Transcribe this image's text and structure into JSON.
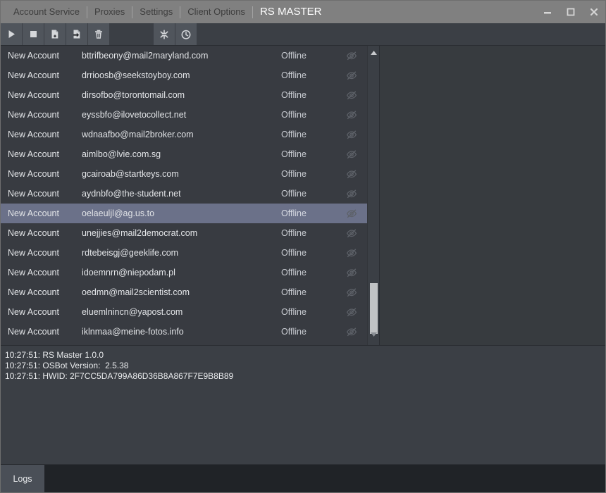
{
  "window": {
    "title": "RS MASTER",
    "menu": [
      "Account Service",
      "Proxies",
      "Settings",
      "Client Options"
    ],
    "controls": {
      "minimize": "minimize-icon",
      "maximize": "maximize-icon",
      "close": "close-icon"
    }
  },
  "toolbar": {
    "buttons": [
      {
        "icon": "play-icon",
        "name": "start-button"
      },
      {
        "icon": "stop-icon",
        "name": "stop-button"
      },
      {
        "icon": "add-file-icon",
        "name": "add-account-button"
      },
      {
        "icon": "import-file-icon",
        "name": "import-accounts-button"
      },
      {
        "icon": "trash-icon",
        "name": "delete-account-button"
      }
    ],
    "buttons_right": [
      {
        "icon": "tools-icon",
        "name": "tools-button"
      },
      {
        "icon": "clock-icon",
        "name": "scheduler-button"
      }
    ]
  },
  "accounts": {
    "status_icon": "eye-hidden-icon",
    "selected_index": 8,
    "rows": [
      {
        "name": "New Account",
        "email": "bttrifbeony@mail2maryland.com",
        "status": "Offline"
      },
      {
        "name": "New Account",
        "email": "drrioosb@seekstoyboy.com",
        "status": "Offline"
      },
      {
        "name": "New Account",
        "email": "dirsofbo@torontomail.com",
        "status": "Offline"
      },
      {
        "name": "New Account",
        "email": "eyssbfo@ilovetocollect.net",
        "status": "Offline"
      },
      {
        "name": "New Account",
        "email": "wdnaafbo@mail2broker.com",
        "status": "Offline"
      },
      {
        "name": "New Account",
        "email": "aimlbo@lvie.com.sg",
        "status": "Offline"
      },
      {
        "name": "New Account",
        "email": "gcairoab@startkeys.com",
        "status": "Offline"
      },
      {
        "name": "New Account",
        "email": "aydnbfo@the-student.net",
        "status": "Offline"
      },
      {
        "name": "New Account",
        "email": "oelaeuljl@ag.us.to",
        "status": "Offline"
      },
      {
        "name": "New Account",
        "email": "unejjies@mail2democrat.com",
        "status": "Offline"
      },
      {
        "name": "New Account",
        "email": "rdtebeisgj@geeklife.com",
        "status": "Offline"
      },
      {
        "name": "New Account",
        "email": "idoemnrn@niepodam.pl",
        "status": "Offline"
      },
      {
        "name": "New Account",
        "email": "oedmn@mail2scientist.com",
        "status": "Offline"
      },
      {
        "name": "New Account",
        "email": "eluemlnincn@yapost.com",
        "status": "Offline"
      },
      {
        "name": "New Account",
        "email": "iklnmaa@meine-fotos.info",
        "status": "Offline"
      }
    ]
  },
  "log": {
    "lines": [
      "10:27:51: RS Master 1.0.0",
      "10:27:51: OSBot Version:  2.5.38",
      "10:27:51: HWID: 2F7CC5DA799A86D36B8A867F7E9B8B89"
    ]
  },
  "tabs": [
    {
      "label": "Logs",
      "active": true
    }
  ],
  "colors": {
    "titlebar": "#808080",
    "toolbar": "#3b3f45",
    "list_bg": "#383b41",
    "selection": "#6b7189",
    "right_pane": "#373b3f",
    "tabbar": "#202327",
    "text": "#e3e5e8"
  }
}
